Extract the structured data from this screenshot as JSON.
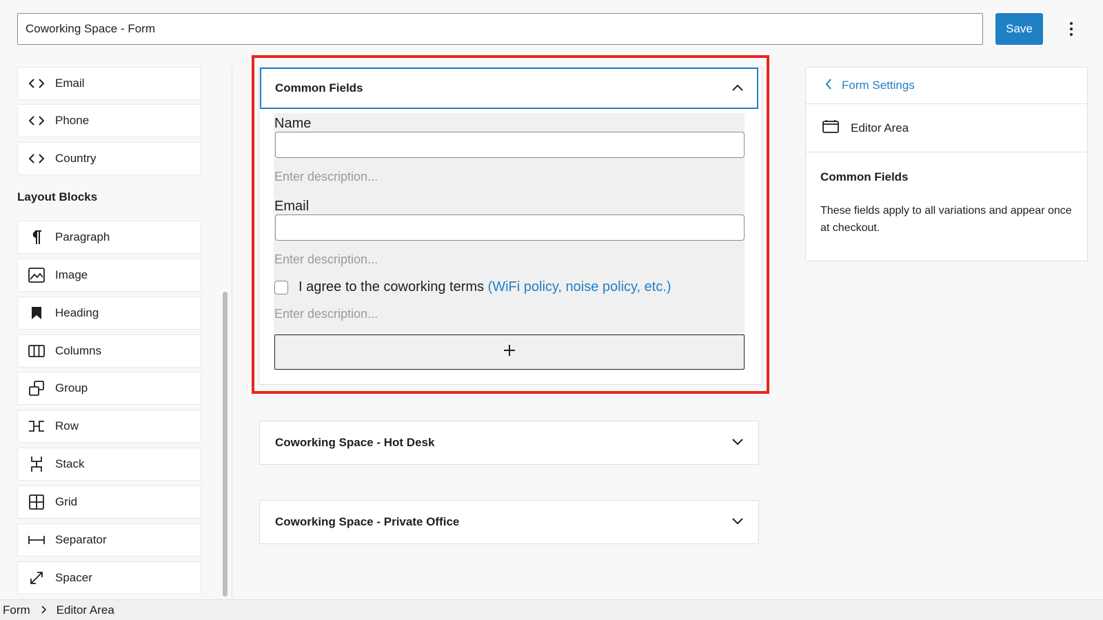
{
  "header": {
    "title_value": "Coworking Space - Form",
    "save_label": "Save"
  },
  "sidebar": {
    "blocks_top": [
      {
        "label": "Email",
        "icon": "code-icon"
      },
      {
        "label": "Phone",
        "icon": "code-icon"
      },
      {
        "label": "Country",
        "icon": "code-icon"
      }
    ],
    "layout_title": "Layout Blocks",
    "layout_blocks": [
      {
        "label": "Paragraph",
        "icon": "paragraph-icon"
      },
      {
        "label": "Image",
        "icon": "image-icon"
      },
      {
        "label": "Heading",
        "icon": "bookmark-icon"
      },
      {
        "label": "Columns",
        "icon": "columns-icon"
      },
      {
        "label": "Group",
        "icon": "group-icon"
      },
      {
        "label": "Row",
        "icon": "row-icon"
      },
      {
        "label": "Stack",
        "icon": "stack-icon"
      },
      {
        "label": "Grid",
        "icon": "grid-icon"
      },
      {
        "label": "Separator",
        "icon": "separator-icon"
      },
      {
        "label": "Spacer",
        "icon": "spacer-icon"
      }
    ]
  },
  "editor": {
    "common": {
      "title": "Common Fields",
      "name_label": "Name",
      "email_label": "Email",
      "desc_placeholder": "Enter description...",
      "agree_text": "I agree to the coworking terms",
      "agree_link": "(WiFi policy, noise policy, etc.)",
      "add_label": "+"
    },
    "variations": [
      {
        "title": "Coworking Space - Hot Desk"
      },
      {
        "title": "Coworking Space - Private Office"
      }
    ]
  },
  "settings": {
    "back_label": "Form Settings",
    "area_label": "Editor Area",
    "heading": "Common Fields",
    "description": "These fields apply to all variations and appear once at checkout."
  },
  "breadcrumb": {
    "items": [
      "Form",
      "Editor Area"
    ]
  },
  "colors": {
    "accent": "#1f80c6",
    "highlight": "#e8251f"
  }
}
